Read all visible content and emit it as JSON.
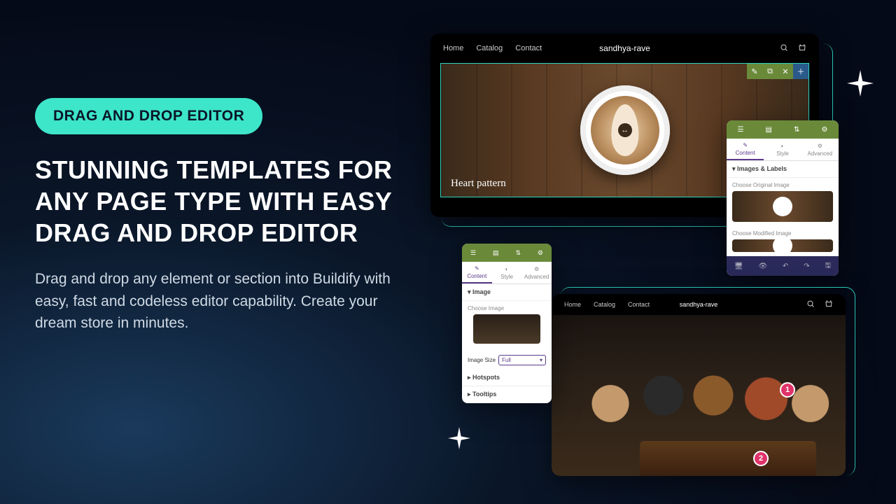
{
  "left": {
    "pill": "DRAG AND DROP EDITOR",
    "headline": "STUNNING TEMPLATES FOR ANY PAGE TYPE WITH EASY DRAG AND DROP EDITOR",
    "description": "Drag and drop any element or section into Buildify with easy, fast and codeless editor capability. Create your dream store in minutes."
  },
  "store": {
    "nav": {
      "home": "Home",
      "catalog": "Catalog",
      "contact": "Contact"
    },
    "title": "sandhya-rave"
  },
  "hero": {
    "caption": "Heart pattern"
  },
  "panel": {
    "tabs": {
      "content": "Content",
      "style": "Style",
      "advanced": "Advanced"
    },
    "section_images_labels": "Images & Labels",
    "choose_original": "Choose Original Image",
    "choose_modified": "Choose Modified Image",
    "section_image": "Image",
    "choose_image": "Choose Image",
    "image_size_label": "Image Size",
    "image_size_value": "Full",
    "section_hotspots": "Hotspots",
    "section_tooltips": "Tooltips"
  },
  "hotspots": {
    "one": "1",
    "two": "2"
  }
}
